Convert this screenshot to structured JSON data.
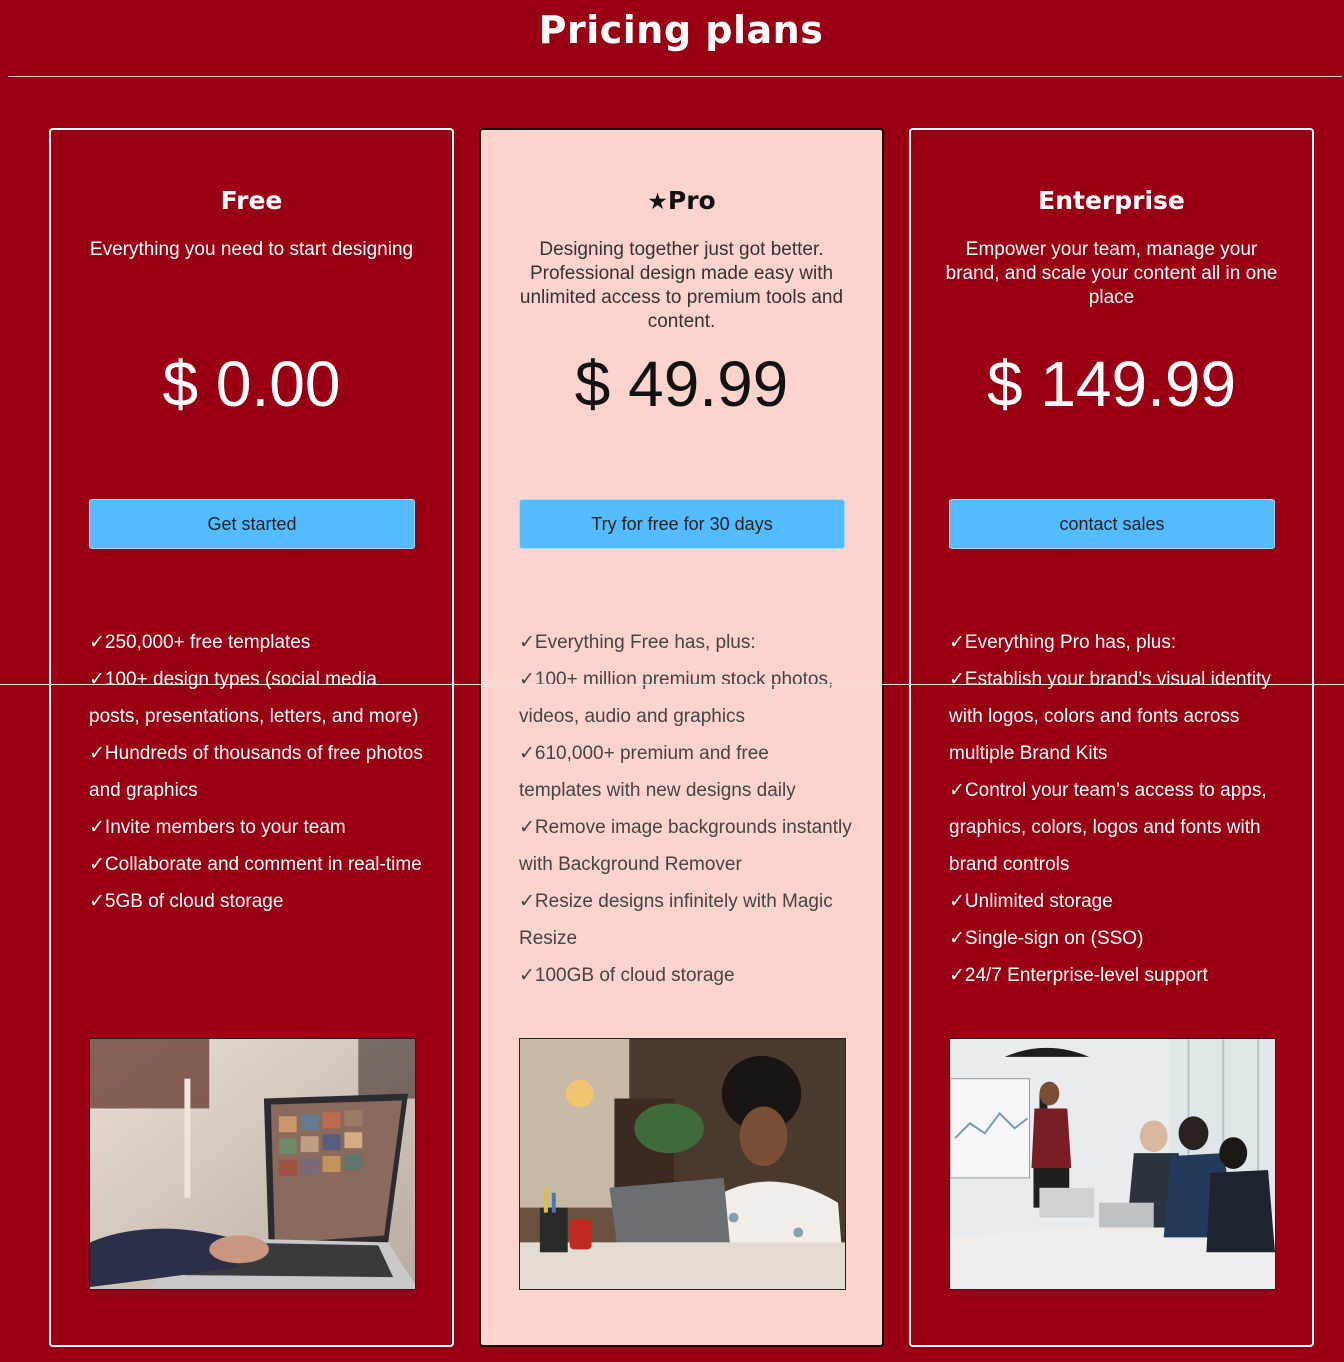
{
  "header": {
    "title": "Pricing plans"
  },
  "plans": [
    {
      "name": "Free",
      "description": "Everything you need to start designing",
      "price": "$ 0.00",
      "cta_label": "Get started",
      "features": [
        "250,000+ free templates",
        "100+ design types (social media posts, presentations, letters, and more)",
        "Hundreds of thousands of free photos and graphics",
        "Invite members to your team",
        "Collaborate and comment in real-time",
        "5GB of cloud storage"
      ]
    },
    {
      "name": "Pro",
      "description": "Designing together just got better. Professional design made easy with unlimited access to premium tools and content.",
      "price": "$ 49.99",
      "cta_label": "Try for free for 30 days",
      "badge_icon": "star-icon",
      "features": [
        "Everything Free has, plus:",
        "100+ million premium stock photos, videos, audio and graphics",
        "610,000+ premium and free templates with new designs daily",
        "Remove image backgrounds instantly with Background Remover",
        "Resize designs infinitely with Magic Resize",
        "100GB of cloud storage"
      ]
    },
    {
      "name": "Enterprise",
      "description": "Empower your team, manage your brand, and scale your content all in one place",
      "price": "$ 149.99",
      "cta_label": "contact sales",
      "features": [
        "Everything Pro has, plus:",
        "Establish your brand’s visual identity with logos, colors and fonts across multiple Brand Kits",
        "Control your team’s access to apps, graphics, colors, logos and fonts with brand controls",
        "Unlimited storage",
        "Single-sign on (SSO)",
        "24/7 Enterprise-level support"
      ]
    }
  ],
  "colors": {
    "background": "#9a0013",
    "pro_card": "#fdd3ce",
    "cta": "#52bcff"
  }
}
